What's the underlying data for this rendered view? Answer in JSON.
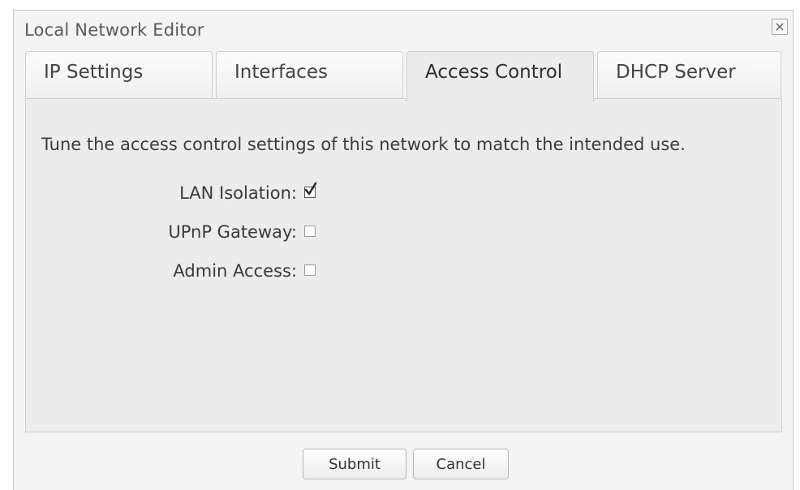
{
  "window": {
    "title": "Local Network Editor",
    "close_icon": "close-icon"
  },
  "tabs": [
    {
      "label": "IP Settings",
      "active": false
    },
    {
      "label": "Interfaces",
      "active": false
    },
    {
      "label": "Access Control",
      "active": true
    },
    {
      "label": "DHCP Server",
      "active": false
    }
  ],
  "panel": {
    "description": "Tune the access control settings of this network to match the intended use.",
    "fields": [
      {
        "label": "LAN Isolation:",
        "checked": true
      },
      {
        "label": "UPnP Gateway:",
        "checked": false
      },
      {
        "label": "Admin Access:",
        "checked": false
      }
    ]
  },
  "footer": {
    "submit_label": "Submit",
    "cancel_label": "Cancel"
  }
}
